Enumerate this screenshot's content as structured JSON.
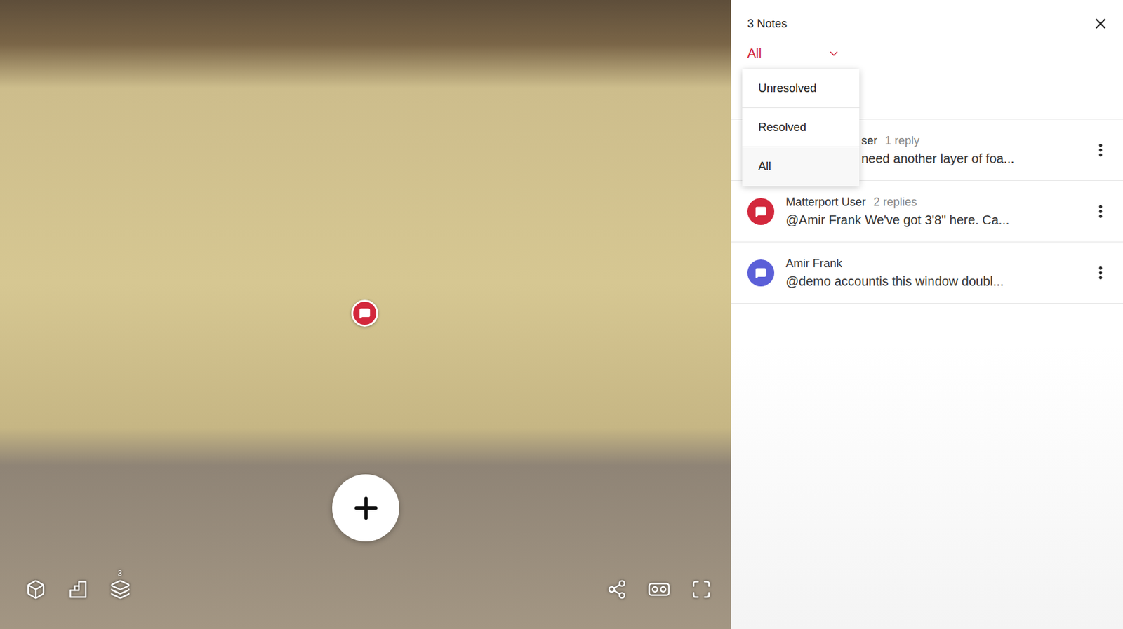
{
  "view": {
    "note_pin": {
      "color": "#d3283c"
    },
    "floor_count": "3"
  },
  "panel": {
    "title": "3 Notes",
    "filter": {
      "label": "All",
      "open": true,
      "options": [
        {
          "label": "Unresolved",
          "selected": false
        },
        {
          "label": "Resolved",
          "selected": false
        },
        {
          "label": "All",
          "selected": true
        }
      ]
    }
  },
  "notes": [
    {
      "author": "ser",
      "replies": "1 reply",
      "text": "need another layer of foa...",
      "color": "#d3283c"
    },
    {
      "author": "Matterport User",
      "replies": "2 replies",
      "text": "@Amir Frank We've got 3'8\" here. Ca...",
      "color": "#d3283c"
    },
    {
      "author": "Amir Frank",
      "text": "@demo accountis this window doubl...",
      "color": "#5b5fd8"
    }
  ]
}
